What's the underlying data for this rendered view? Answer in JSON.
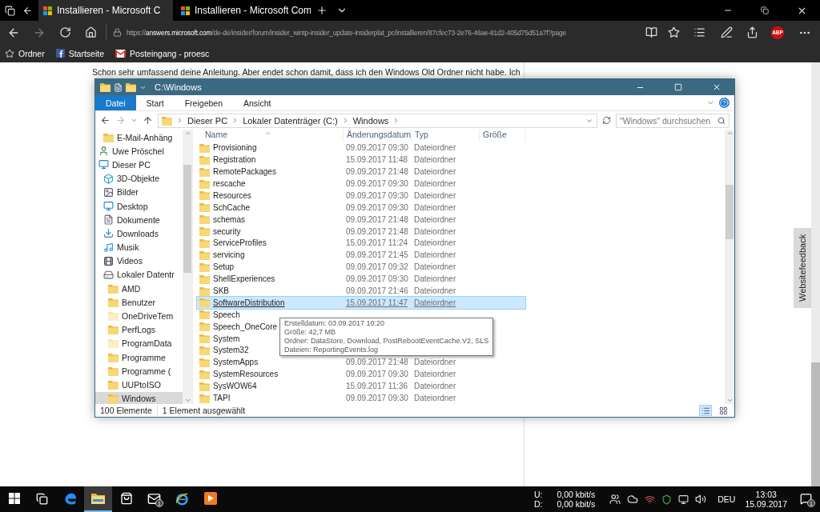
{
  "browser": {
    "tabs": [
      {
        "title": "Installieren - Microsoft C",
        "selected": true
      },
      {
        "title": "Installieren - Microsoft Com",
        "selected": false
      }
    ],
    "address": "https://**answers.microsoft.com**/de-de/insider/forum/insider_wintp-insider_update-insiderplat_pc/installieren/87cfec73-2e76-46ae-81d2-405d75d51a7f?page",
    "adblock_badge": "ABP",
    "favorites": [
      {
        "label": "Ordner",
        "kind": "star"
      },
      {
        "label": "Startseite",
        "kind": "facebook"
      },
      {
        "label": "Posteingang - proesc",
        "kind": "mail"
      }
    ]
  },
  "page": {
    "lines": [
      "Schon sehr umfassend deine Anleitung. Aber endet schon damit, dass ich den Windows Old Ordner nicht habe. Ich"
    ],
    "feedback_tab": "Websitefeedback"
  },
  "explorer": {
    "title": "C:\\Windows",
    "ribbon_tabs": [
      {
        "label": "Datei",
        "selected": true
      },
      {
        "label": "Start",
        "selected": false
      },
      {
        "label": "Freigeben",
        "selected": false
      },
      {
        "label": "Ansicht",
        "selected": false
      }
    ],
    "breadcrumb": [
      "Dieser PC",
      "Lokaler Datenträger (C:)",
      "Windows"
    ],
    "search": {
      "placeholder": "\"Windows\" durchsuchen"
    },
    "nav_tree": [
      {
        "children": [
          {
            "label": "E-Mail-Anhäng",
            "kind": "folder",
            "selected": false
          }
        ]
      },
      {
        "label": "Uwe Pröschel",
        "kind": "user",
        "selected": false
      },
      {
        "label": "Dieser PC",
        "kind": "pc",
        "selected": false,
        "children": [
          {
            "label": "3D-Objekte",
            "kind": "objects3d",
            "selected": false
          },
          {
            "label": "Bilder",
            "kind": "pictures",
            "selected": false
          },
          {
            "label": "Desktop",
            "kind": "desktop",
            "selected": false
          },
          {
            "label": "Dokumente",
            "kind": "documents",
            "selected": false
          },
          {
            "label": "Downloads",
            "kind": "downloads",
            "selected": false
          },
          {
            "label": "Musik",
            "kind": "music",
            "selected": false
          },
          {
            "label": "Videos",
            "kind": "videos",
            "selected": false
          },
          {
            "label": "Lokaler Datentr",
            "kind": "drive",
            "selected": false,
            "children": [
              {
                "label": "AMD",
                "kind": "folder",
                "selected": false
              },
              {
                "label": "Benutzer",
                "kind": "folder",
                "selected": false
              },
              {
                "label": "OneDriveTem",
                "kind": "folder",
                "hidden": true,
                "selected": false
              },
              {
                "label": "PerfLogs",
                "kind": "folder",
                "selected": false
              },
              {
                "label": "ProgramData",
                "kind": "folder",
                "hidden": true,
                "selected": false
              },
              {
                "label": "Programme",
                "kind": "folder",
                "selected": false
              },
              {
                "label": "Programme (",
                "kind": "folder",
                "selected": false
              },
              {
                "label": "UUPtoISO",
                "kind": "folder",
                "selected": false
              },
              {
                "label": "Windows",
                "kind": "folder",
                "selected": true
              }
            ]
          }
        ]
      }
    ],
    "columns": [
      "Name",
      "Änderungsdatum",
      "Typ",
      "Größe"
    ],
    "files": [
      {
        "name": "Provisioning",
        "date": "09.09.2017 09:30",
        "type": "Dateiordner",
        "selected": false
      },
      {
        "name": "Registration",
        "date": "15.09.2017 11:48",
        "type": "Dateiordner",
        "selected": false
      },
      {
        "name": "RemotePackages",
        "date": "09.09.2017 21:48",
        "type": "Dateiordner",
        "selected": false
      },
      {
        "name": "rescache",
        "date": "09.09.2017 09:30",
        "type": "Dateiordner",
        "selected": false
      },
      {
        "name": "Resources",
        "date": "09.09.2017 09:30",
        "type": "Dateiordner",
        "selected": false
      },
      {
        "name": "SchCache",
        "date": "09.09.2017 09:30",
        "type": "Dateiordner",
        "selected": false
      },
      {
        "name": "schemas",
        "date": "09.09.2017 21:48",
        "type": "Dateiordner",
        "selected": false
      },
      {
        "name": "security",
        "date": "09.09.2017 21:48",
        "type": "Dateiordner",
        "selected": false
      },
      {
        "name": "ServiceProfiles",
        "date": "15.09.2017 11:24",
        "type": "Dateiordner",
        "selected": false
      },
      {
        "name": "servicing",
        "date": "09.09.2017 21:45",
        "type": "Dateiordner",
        "selected": false
      },
      {
        "name": "Setup",
        "date": "09.09.2017 09:32",
        "type": "Dateiordner",
        "selected": false
      },
      {
        "name": "ShellExperiences",
        "date": "09.09.2017 09:30",
        "type": "Dateiordner",
        "selected": false
      },
      {
        "name": "SKB",
        "date": "09.09.2017 21:46",
        "type": "Dateiordner",
        "selected": false
      },
      {
        "name": "SoftwareDistribution",
        "date": "15.09.2017 11:47",
        "type": "Dateiordner",
        "selected": true
      },
      {
        "name": "Speech",
        "selected": false
      },
      {
        "name": "Speech_OneCore",
        "selected": false
      },
      {
        "name": "System",
        "selected": false
      },
      {
        "name": "System32",
        "selected": false
      },
      {
        "name": "SystemApps",
        "date": "09.09.2017 21:48",
        "type": "Dateiordner",
        "selected": false
      },
      {
        "name": "SystemResources",
        "date": "09.09.2017 09:30",
        "type": "Dateiordner",
        "selected": false
      },
      {
        "name": "SysWOW64",
        "date": "15.09.2017 11:36",
        "type": "Dateiordner",
        "selected": false
      },
      {
        "name": "TAPI",
        "date": "09.09.2017 09:30",
        "type": "Dateiordner",
        "selected": false
      }
    ],
    "tooltip": [
      "Erstelldatum: 03.09.2017 10:20",
      "Größe: 42,7 MB",
      "Ordner: DataStore, Download, PostRebootEventCache.V2, SLS",
      "Dateien: ReportingEvents.log"
    ],
    "status": [
      "100 Elemente",
      "1 Element ausgewählt"
    ]
  },
  "taskbar": {
    "apps": [
      {
        "kind": "start",
        "selected": false
      },
      {
        "kind": "taskview",
        "selected": false
      },
      {
        "kind": "edge",
        "selected": false
      },
      {
        "kind": "explorer",
        "selected": true
      },
      {
        "kind": "store",
        "selected": false
      },
      {
        "kind": "mail",
        "selected": false,
        "badge": "1"
      },
      {
        "kind": "ie",
        "selected": false
      },
      {
        "kind": "media",
        "selected": false
      }
    ],
    "net_labels": [
      "U:",
      "D:"
    ],
    "net_rates": [
      "0,00 kbit/s",
      "0,00 kbit/s"
    ],
    "language": "DEU",
    "time": "13:03",
    "date": "15.09.2017",
    "notification_badge": "1"
  }
}
